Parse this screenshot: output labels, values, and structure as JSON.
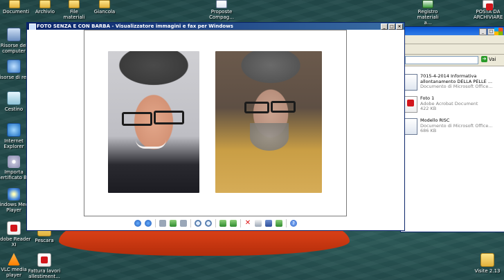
{
  "desktop": {
    "top_icons": [
      {
        "label": "Documenti",
        "icon": "folder-icon"
      },
      {
        "label": "Archivio",
        "icon": "folder-icon"
      },
      {
        "label": "File materiali",
        "icon": "folder-icon"
      },
      {
        "label": "Giancola",
        "icon": "folder-icon"
      },
      {
        "label": "Proposte Compag...",
        "icon": "document-icon"
      },
      {
        "label": "Registro materiali a...",
        "icon": "spreadsheet-icon"
      },
      {
        "label": "POSTA DA ARCHIVIARE",
        "icon": "pdf-icon"
      }
    ],
    "left_icons": [
      {
        "label": "Risorse del computer",
        "icon": "computer-icon"
      },
      {
        "label": "Risorse di rete",
        "icon": "network-icon"
      },
      {
        "label": "Cestino",
        "icon": "recycle-bin-icon"
      },
      {
        "label": "Internet Explorer",
        "icon": "ie-icon"
      },
      {
        "label": "Importa Certificato BD",
        "icon": "cd-icon"
      },
      {
        "label": "Windows Media Player",
        "icon": "media-player-icon"
      },
      {
        "label": "Adobe Reader XI",
        "icon": "pdf-icon"
      },
      {
        "label": "VLC media player",
        "icon": "vlc-icon"
      }
    ],
    "other_icons": [
      {
        "label": "Pescara",
        "icon": "folder-icon"
      },
      {
        "label": "Fattura lavori allestiment...",
        "icon": "pdf-icon"
      },
      {
        "label": "Visite 2.13",
        "icon": "folder-icon"
      }
    ]
  },
  "viewer": {
    "title": "FOTO SENZA E CON BARBA - Visualizzatore immagini e fax per Windows",
    "controls": [
      "_",
      "□",
      "×"
    ],
    "toolbar_icons": [
      "previous-image-icon",
      "next-image-icon",
      "best-fit-icon",
      "actual-size-icon",
      "slideshow-icon",
      "zoom-in-icon",
      "zoom-out-icon",
      "rotate-clockwise-icon",
      "rotate-counterclockwise-icon",
      "delete-icon",
      "print-icon",
      "save-icon",
      "edit-icon",
      "help-icon"
    ]
  },
  "explorer": {
    "go_label": "Vai",
    "files": [
      {
        "name": "7015-4-2014 Informativa allontanamento DELLA PELLE ...",
        "type": "Documento di Microsoft Office...",
        "size": "",
        "icon": "word-document-icon"
      },
      {
        "name": "Foto 1",
        "type": "Adobe Acrobat Document",
        "size": "422 KB",
        "icon": "pdf-icon"
      },
      {
        "name": "Modello RISC",
        "type": "Documento di Microsoft Office...",
        "size": "686 KB",
        "icon": "word-document-icon"
      }
    ]
  }
}
